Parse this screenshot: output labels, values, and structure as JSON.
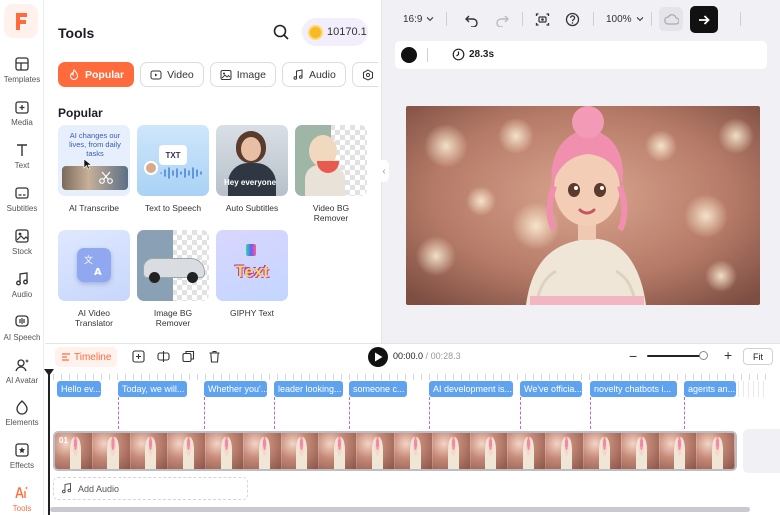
{
  "sidebar": {
    "logo": "F",
    "items": [
      {
        "label": "Templates",
        "icon": "templates-icon"
      },
      {
        "label": "Media",
        "icon": "media-icon"
      },
      {
        "label": "Text",
        "icon": "text-icon"
      },
      {
        "label": "Subtitles",
        "icon": "subtitles-icon"
      },
      {
        "label": "Stock",
        "icon": "stock-icon"
      },
      {
        "label": "Audio",
        "icon": "audio-icon"
      },
      {
        "label": "AI Speech",
        "icon": "ai-speech-icon"
      },
      {
        "label": "AI Avatar",
        "icon": "ai-avatar-icon"
      },
      {
        "label": "Elements",
        "icon": "elements-icon"
      },
      {
        "label": "Effects",
        "icon": "effects-icon"
      },
      {
        "label": "Tools",
        "icon": "tools-icon",
        "active": true
      }
    ]
  },
  "tools_panel": {
    "title": "Tools",
    "credits": "10170.1",
    "categories": [
      {
        "label": "Popular",
        "active": true
      },
      {
        "label": "Video"
      },
      {
        "label": "Image"
      },
      {
        "label": "Audio"
      },
      {
        "label": "C"
      }
    ],
    "section_title": "Popular",
    "tiles": [
      {
        "label": "AI Transcribe",
        "thumb_text": "AI changes our lives, from daily tasks"
      },
      {
        "label": "Text to Speech",
        "thumb_text": "TXT"
      },
      {
        "label": "Auto Subtitles",
        "thumb_text": "Hey everyone"
      },
      {
        "label": "Video BG Remover"
      },
      {
        "label": "AI Video Translator",
        "thumb_text": "文 A"
      },
      {
        "label": "Image BG Remover"
      },
      {
        "label": "GIPHY Text",
        "thumb_text": "Text"
      }
    ]
  },
  "toolbar": {
    "ratio": "16:9",
    "zoom": "100%",
    "duration": "28.3s"
  },
  "timeline": {
    "tab": "Timeline",
    "current_time": "00:00.0",
    "separator": "/",
    "total_time": "00:28.3",
    "fit_label": "Fit",
    "track_number": "01",
    "add_audio": "Add Audio",
    "subtitles": [
      "Hello ev...",
      "Today, we will...",
      "Whether you'...",
      "leader looking...",
      "someone c...",
      "AI development is...",
      "We've officia...",
      "novelty chatbots i...",
      "agents an..."
    ]
  },
  "colors": {
    "accent": "#ff6b3d",
    "subtitle_chip": "#5fa3f0",
    "export_button": "#111111"
  }
}
